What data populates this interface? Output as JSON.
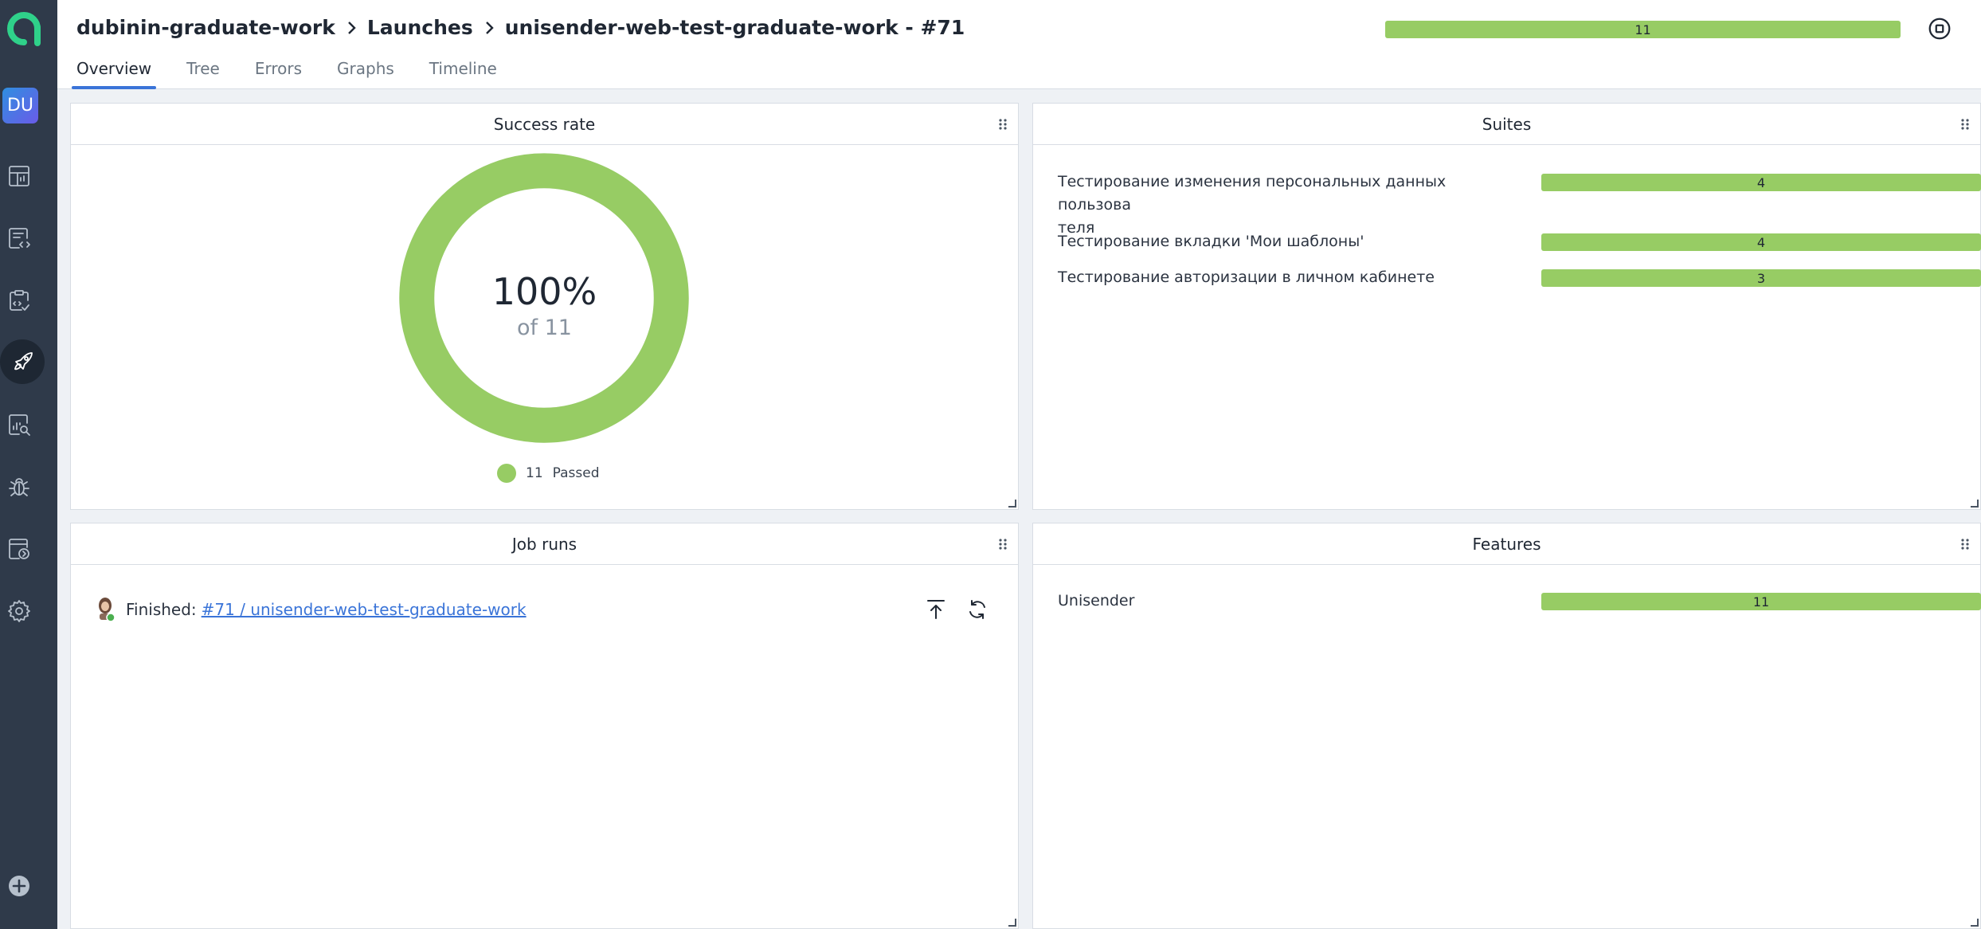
{
  "header": {
    "breadcrumb": [
      "dubinin-graduate-work",
      "Launches",
      "unisender-web-test-graduate-work - #71"
    ],
    "progress_count": "11",
    "tabs": [
      "Overview",
      "Tree",
      "Errors",
      "Graphs",
      "Timeline"
    ],
    "active_tab": "Overview"
  },
  "sidebar": {
    "avatar_initials": "DU",
    "items": [
      "dashboards-icon",
      "test-cases-icon",
      "test-plans-icon",
      "launches-icon",
      "analytics-icon",
      "defects-icon",
      "jobs-icon",
      "settings-icon"
    ],
    "active_item": "launches-icon"
  },
  "colors": {
    "passed": "#97cc64",
    "sidebar": "#2f3a4a",
    "link": "#3a74d8",
    "accent": "#3a74d8"
  },
  "success_rate": {
    "title": "Success rate",
    "percent": "100%",
    "of_label": "of 11",
    "passed_fraction": 1.0,
    "legend_count": "11",
    "legend_label": "Passed"
  },
  "suites": {
    "title": "Suites",
    "items": [
      {
        "label": "Тестирование изменения персональных данных пользова\nтеля",
        "count": "4"
      },
      {
        "label": "Тестирование вкладки 'Мои шаблоны'",
        "count": "4"
      },
      {
        "label": "Тестирование авторизации в личном кабинете",
        "count": "3"
      }
    ]
  },
  "job_runs": {
    "title": "Job runs",
    "status": "Finished:",
    "link": "#71 / unisender-web-test-graduate-work"
  },
  "features": {
    "title": "Features",
    "items": [
      {
        "label": "Unisender",
        "count": "11"
      }
    ]
  }
}
